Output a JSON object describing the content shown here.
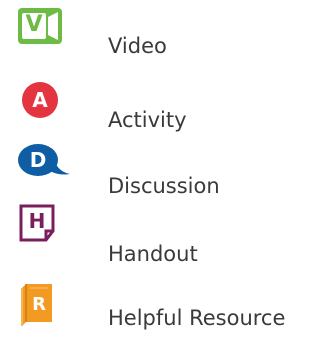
{
  "legend": {
    "items": [
      {
        "id": "video",
        "label": "Video",
        "icon_letter": "V",
        "icon": "video-camera-icon",
        "color": "#6dbb45"
      },
      {
        "id": "activity",
        "label": "Activity",
        "icon_letter": "A",
        "icon": "activity-circle-icon",
        "color": "#e3343f"
      },
      {
        "id": "discussion",
        "label": "Discussion",
        "icon_letter": "D",
        "icon": "speech-bubble-icon",
        "color": "#0e5da5"
      },
      {
        "id": "handout",
        "label": "Handout",
        "icon_letter": "H",
        "icon": "page-icon",
        "color": "#7a1f5c"
      },
      {
        "id": "resource",
        "label": "Helpful Resource",
        "icon_letter": "R",
        "icon": "book-icon",
        "color": "#f39a23"
      }
    ]
  }
}
